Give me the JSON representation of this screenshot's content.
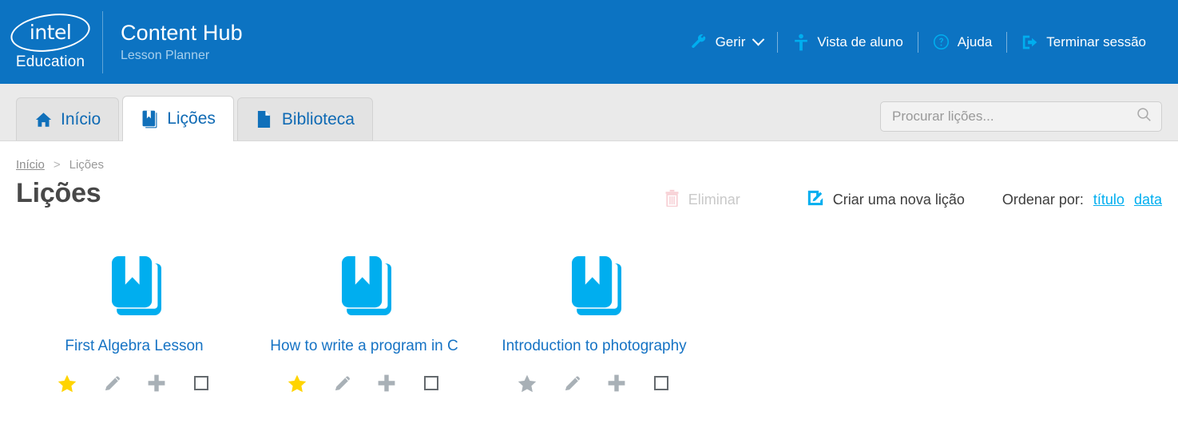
{
  "header": {
    "logo_word": "intel",
    "logo_sub": "Education",
    "title": "Content Hub",
    "subtitle": "Lesson Planner",
    "nav": [
      {
        "label": "Gerir",
        "icon": "wrench-icon",
        "has_caret": true
      },
      {
        "label": "Vista de aluno",
        "icon": "student-icon",
        "has_caret": false
      },
      {
        "label": "Ajuda",
        "icon": "help-circle-icon",
        "has_caret": false
      },
      {
        "label": "Terminar sessão",
        "icon": "logout-icon",
        "has_caret": false
      }
    ],
    "brand_color": "#0c73c2",
    "accent_color": "#00aeef"
  },
  "tabs": [
    {
      "label": "Início",
      "icon": "home-icon",
      "active": false
    },
    {
      "label": "Lições",
      "icon": "book-icon",
      "active": true
    },
    {
      "label": "Biblioteca",
      "icon": "document-icon",
      "active": false
    }
  ],
  "search": {
    "placeholder": "Procurar lições...",
    "value": "",
    "icon": "search-icon"
  },
  "breadcrumb": {
    "items": [
      "Início",
      "Lições"
    ],
    "separator": ">"
  },
  "page": {
    "title": "Lições"
  },
  "toolbar": {
    "delete_label": "Eliminar",
    "delete_icon": "trash-icon",
    "delete_disabled": true,
    "create_label": "Criar uma nova lição",
    "create_icon": "edit-square-icon",
    "sort_label": "Ordenar por:",
    "sort_options": [
      "título",
      "data"
    ]
  },
  "lessons": [
    {
      "title": "First Algebra Lesson",
      "icon": "lesson-book-icon",
      "favorite": true,
      "tools": [
        "star-icon",
        "pencil-icon",
        "plus-icon",
        "checkbox-icon"
      ]
    },
    {
      "title": "How to write a program in C",
      "icon": "lesson-book-icon",
      "favorite": true,
      "tools": [
        "star-icon",
        "pencil-icon",
        "plus-icon",
        "checkbox-icon"
      ]
    },
    {
      "title": "Introduction to photography",
      "icon": "lesson-book-icon",
      "favorite": false,
      "tools": [
        "star-icon",
        "pencil-icon",
        "plus-icon",
        "checkbox-icon"
      ]
    }
  ],
  "colors": {
    "star_on": "#ffd400",
    "star_off": "#a8b0b6",
    "lesson_icon": "#00aeef",
    "tool_grey": "#a8b0b6"
  }
}
